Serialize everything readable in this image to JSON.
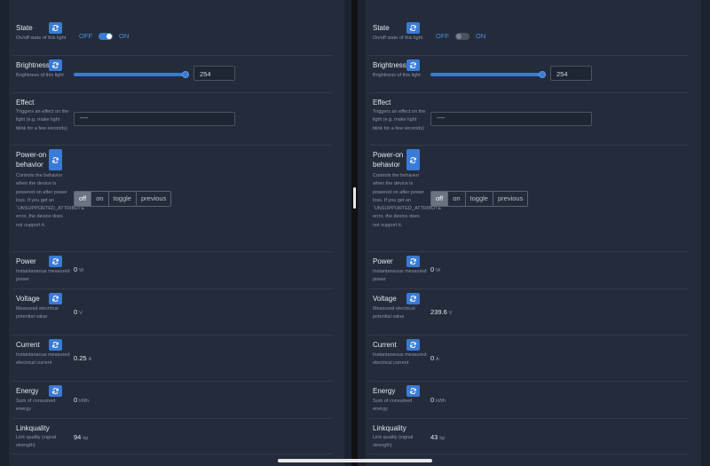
{
  "panes": [
    {
      "state": {
        "name": "State",
        "desc": "On/off state of this light",
        "off_label": "OFF",
        "on_label": "ON",
        "value": "on"
      },
      "brightness": {
        "name": "Brightness",
        "desc": "Brightness of this light",
        "value": "254",
        "level_fraction": 1.0
      },
      "effect": {
        "name": "Effect",
        "desc": "Triggers an effect on the light (e.g. make light blink for a few seconds)",
        "value": "----"
      },
      "power_on": {
        "name": "Power-on behavior",
        "desc": "Controls the behavior when the device is powered on after power loss. If you get an `UNSUPPORTED_ATTRIBUTE` error, the device does not support it.",
        "options": [
          "off",
          "on",
          "toggle",
          "previous"
        ],
        "selected": "off"
      },
      "power": {
        "name": "Power",
        "desc": "Instantaneous measured power",
        "value": "0",
        "unit": "W"
      },
      "voltage": {
        "name": "Voltage",
        "desc": "Measured electrical potential value",
        "value": "0",
        "unit": "V"
      },
      "current": {
        "name": "Current",
        "desc": "Instantaneous measured electrical current",
        "value": "0.25",
        "unit": "A"
      },
      "energy": {
        "name": "Energy",
        "desc": "Sum of consumed energy",
        "value": "0",
        "unit": "kWh"
      },
      "linkquality": {
        "name": "Linkquality",
        "desc": "Link quality (signal strength)",
        "value": "94",
        "unit": "lqi"
      }
    },
    {
      "state": {
        "name": "State",
        "desc": "On/off state of this light",
        "off_label": "OFF",
        "on_label": "ON",
        "value": "off"
      },
      "brightness": {
        "name": "Brightness",
        "desc": "Brightness of this light",
        "value": "254",
        "level_fraction": 1.0
      },
      "effect": {
        "name": "Effect",
        "desc": "Triggers an effect on the light (e.g. make light blink for a few seconds)",
        "value": "----"
      },
      "power_on": {
        "name": "Power-on behavior",
        "desc": "Controls the behavior when the device is powered on after power loss. If you get an `UNSUPPORTED_ATTRIBUTE` error, the device does not support it.",
        "options": [
          "off",
          "on",
          "toggle",
          "previous"
        ],
        "selected": "off"
      },
      "power": {
        "name": "Power",
        "desc": "Instantaneous measured power",
        "value": "0",
        "unit": "W"
      },
      "voltage": {
        "name": "Voltage",
        "desc": "Measured electrical potential value",
        "value": "239.6",
        "unit": "V"
      },
      "current": {
        "name": "Current",
        "desc": "Instantaneous measured electrical current",
        "value": "0",
        "unit": "A"
      },
      "energy": {
        "name": "Energy",
        "desc": "Sum of consumed energy",
        "value": "0",
        "unit": "kWh"
      },
      "linkquality": {
        "name": "Linkquality",
        "desc": "Link quality (signal strength)",
        "value": "43",
        "unit": "lqi"
      }
    }
  ],
  "icons": {
    "refresh": "refresh-icon"
  },
  "colors": {
    "accent": "#3a7bd5",
    "background": "#242c3b",
    "text": "#d3d8e0",
    "muted": "#8d97a6"
  }
}
